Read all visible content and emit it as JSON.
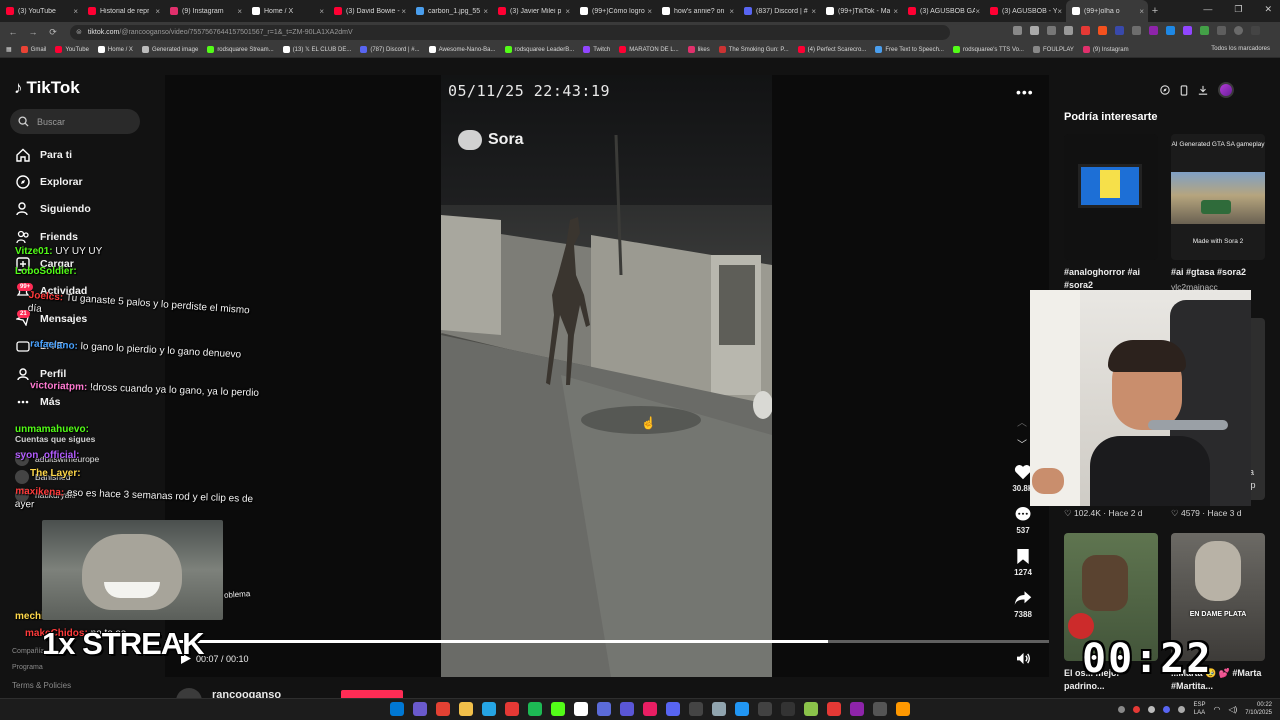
{
  "browser": {
    "tabs": [
      {
        "label": "(3) YouTube",
        "color": "#ff0033"
      },
      {
        "label": "Historial de repr",
        "color": "#ff0033"
      },
      {
        "label": "(9) Instagram",
        "color": "#e1306c"
      },
      {
        "label": "Home / X",
        "color": "#ffffff"
      },
      {
        "label": "(3) David Bowie -",
        "color": "#ff0033"
      },
      {
        "label": "carbon_1.jpg_55",
        "color": "#4a9eed"
      },
      {
        "label": "(3) Javier Milei p",
        "color": "#ff0033"
      },
      {
        "label": "(99+)Cómo logro",
        "color": "#ffffff"
      },
      {
        "label": "how's annie? on",
        "color": "#ffffff"
      },
      {
        "label": "(837) Discord | #",
        "color": "#5865f2"
      },
      {
        "label": "(99+)TikTok - Ma",
        "color": "#ffffff"
      },
      {
        "label": "(3) AGUSBOB GA",
        "color": "#ff0033"
      },
      {
        "label": "(3) AGUSBOB - Y",
        "color": "#ff0033"
      },
      {
        "label": "(99+)olha o",
        "color": "#ffffff",
        "active": true
      }
    ],
    "new_tab": "+",
    "window_controls": [
      "—",
      "❐",
      "✕"
    ],
    "url_host": "tiktok.com",
    "url_path": "/@rancooganso/video/7557567644157501567_r=1&_t=ZM-90LA1XA2dmV",
    "bookmarks": [
      {
        "label": "Gmail",
        "color": "#ea4335"
      },
      {
        "label": "YouTube",
        "color": "#ff0033"
      },
      {
        "label": "Home / X",
        "color": "#ffffff"
      },
      {
        "label": "Generated image",
        "color": "#bbbbbb"
      },
      {
        "label": "rodsquaree Stream...",
        "color": "#53fc18"
      },
      {
        "label": "(13) 𝕏 EL CLUB DE...",
        "color": "#ffffff"
      },
      {
        "label": "(787) Discord | #...",
        "color": "#5865f2"
      },
      {
        "label": "Awesome-Nano-Ba...",
        "color": "#ffffff"
      },
      {
        "label": "rodsquaree LeaderB...",
        "color": "#53fc18"
      },
      {
        "label": "Twitch",
        "color": "#9146ff"
      },
      {
        "label": "MARATON DE L...",
        "color": "#ff0033"
      },
      {
        "label": "likes",
        "color": "#e1306c"
      },
      {
        "label": "The Smoking Gun: P...",
        "color": "#cc3333"
      },
      {
        "label": "(4) Perfect Scarecro...",
        "color": "#ff0033"
      },
      {
        "label": "Free Text to Speech...",
        "color": "#4a9eed"
      },
      {
        "label": "rodsquaree's TTS Vo...",
        "color": "#53fc18"
      },
      {
        "label": "FOULPLAY",
        "color": "#888888"
      },
      {
        "label": "(9) Instagram",
        "color": "#e1306c"
      }
    ],
    "bookmarks_all": "Todos los marcadores"
  },
  "sidebar": {
    "logo": "TikTok",
    "search_placeholder": "Buscar",
    "items": [
      {
        "label": "Para ti",
        "icon": "home-icon"
      },
      {
        "label": "Explorar",
        "icon": "compass-icon"
      },
      {
        "label": "Siguiendo",
        "icon": "following-icon"
      },
      {
        "label": "Friends",
        "icon": "friends-icon"
      },
      {
        "label": "Cargar",
        "icon": "upload-icon"
      },
      {
        "label": "Actividad",
        "icon": "activity-icon"
      },
      {
        "label": "Mensajes",
        "icon": "messages-icon"
      },
      {
        "label": "LIVE",
        "icon": "live-icon"
      },
      {
        "label": "Perfil",
        "icon": "profile-icon"
      },
      {
        "label": "Más",
        "icon": "more-icon"
      }
    ],
    "badges": {
      "activity": "99+",
      "messages": "21"
    },
    "following_header": "Cuentas que sigues",
    "following": [
      "adultswimeurope",
      "Banished",
      "natikuryaki"
    ],
    "footer_company": "Compañía",
    "footer_program": "Programa",
    "footer_terms": "Terms & Policies"
  },
  "video": {
    "timestamp": "05/11/25 22:43:19",
    "watermark": "Sora",
    "progress_fraction": 0.75,
    "time_current": "00:07",
    "time_total": "00:10",
    "time_display": "00:07 / 00:10",
    "author": "rancooganso",
    "likes": "30.8K",
    "comments": "537",
    "saves": "1274",
    "shares": "7388"
  },
  "related": {
    "title": "Podría interesarte",
    "items": [
      {
        "caption": "#analoghorror #ai #sora2",
        "likes": ""
      },
      {
        "caption": "#ai #gtasa #sora2",
        "sub": "ylc2mainacc",
        "overlay_top": "AI Generated GTA SA gameplay",
        "overlay_bottom": "Made with Sora 2"
      },
      {
        "caption": "",
        "likes": "102.4K",
        "age": "Hace 2 d"
      },
      {
        "caption": "",
        "likes": "4579",
        "age": "Hace 3 d"
      },
      {
        "caption": "El os... mejor padrino...",
        "likes": ""
      },
      {
        "caption": "...Marta 🥹 💕 #Marta #Martita...",
        "overlay_top": "EN DAME PLATA"
      }
    ]
  },
  "stream_overlay": {
    "chat": [
      {
        "user": "Vitze01:",
        "msg": "UY UY UY",
        "color": "#53fc18"
      },
      {
        "user": "LoboSoldier:",
        "msg": "",
        "color": "#53fc18"
      },
      {
        "user": "Joelcs:",
        "msg": "Tu ganaste 5 palos y lo perdiste el mismo día",
        "color": "#ff3b3b"
      },
      {
        "user": "rafaelano:",
        "msg": "lo gano lo pierdio y lo gano denuevo",
        "color": "#4aa3ff"
      },
      {
        "user": "victoriatpm:",
        "msg": "!dross cuando ya lo gano, ya lo perdio",
        "color": "#ff7ad1"
      },
      {
        "user": "unmamahuevo:",
        "msg": "",
        "color": "#53fc18"
      },
      {
        "user": "syon_official:",
        "msg": "",
        "color": "#b35cff"
      },
      {
        "user": "The Layer:",
        "msg": "",
        "color": "#ffd84a"
      },
      {
        "user": "maxikena:",
        "msg": "eso es hace 3 semanas rod y el clip es de ayer",
        "color": "#ff3b3b"
      },
      {
        "user": "mechidos:",
        "msg": "",
        "color": "#ffd84a"
      },
      {
        "user": "makeChidos:",
        "msg": "no te se...",
        "color": "#ff3b3b"
      }
    ],
    "chat_extra": "oblema",
    "streak": "1x STREAK",
    "timer": "00:22"
  },
  "taskbar": {
    "lang": "ESP\nLAA",
    "time": "00:22",
    "date": "7/10/2025"
  }
}
